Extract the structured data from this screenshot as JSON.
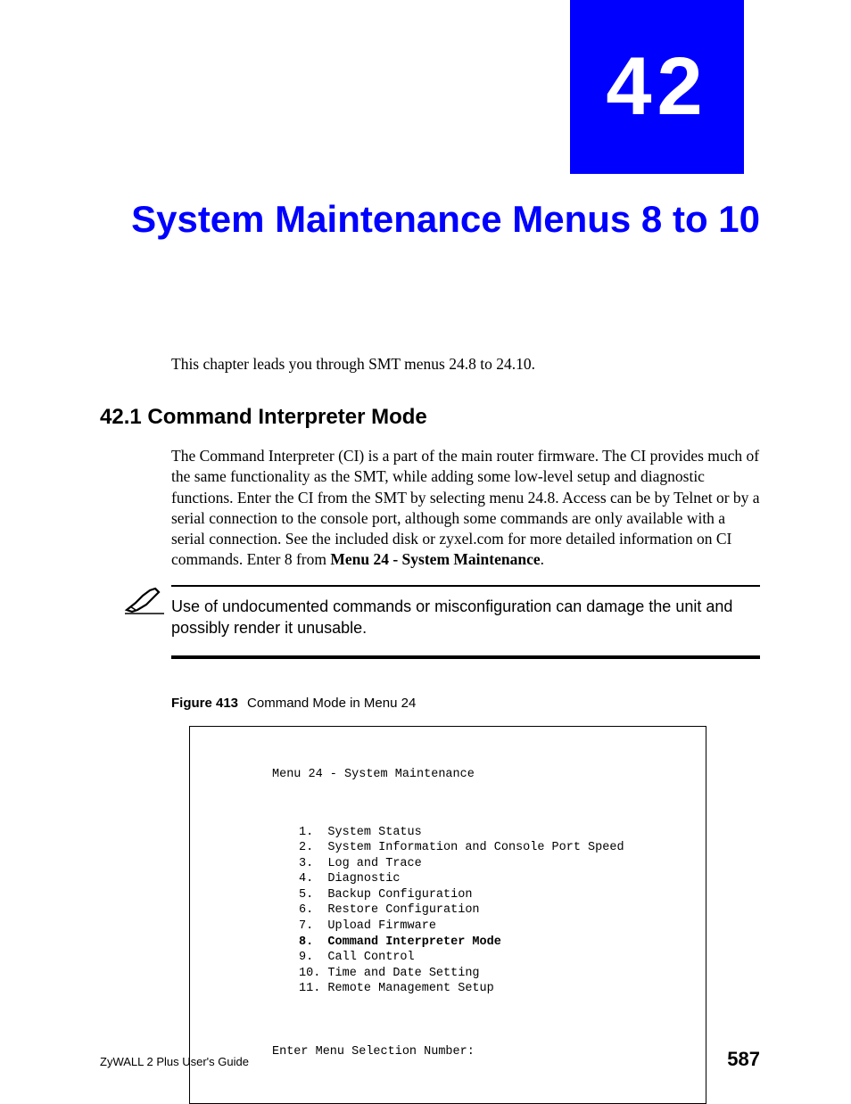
{
  "chapter": {
    "number": "42",
    "title": "System Maintenance Menus 8 to 10"
  },
  "intro": "This chapter leads you through SMT menus 24.8 to 24.10.",
  "section": {
    "heading": "42.1  Command Interpreter Mode",
    "para_part1": "The Command Interpreter (CI) is a part of the main router firmware. The CI provides much of the same functionality as the SMT, while adding some low-level setup and diagnostic functions. Enter the CI from the SMT by selecting menu 24.8. Access can be by Telnet or by a serial connection to the console port, although some commands are only available with a serial connection. See the included disk or zyxel.com for more detailed information on CI commands. Enter 8 from ",
    "para_bold": "Menu 24 - System Maintenance",
    "para_part2": "."
  },
  "note": {
    "text": "Use of undocumented commands or misconfiguration can damage the unit and possibly render it unusable."
  },
  "figure": {
    "label": "Figure 413",
    "caption": "Command Mode in Menu 24",
    "menu_title": "Menu 24 - System Maintenance",
    "items": [
      "1.  System Status",
      "2.  System Information and Console Port Speed",
      "3.  Log and Trace",
      "4.  Diagnostic",
      "5.  Backup Configuration",
      "6.  Restore Configuration",
      "7.  Upload Firmware",
      "8.  Command Interpreter Mode",
      "9.  Call Control",
      "10. Time and Date Setting",
      "11. Remote Management Setup"
    ],
    "highlight_index": 7,
    "prompt": "Enter Menu Selection Number:"
  },
  "footer": {
    "guide": "ZyWALL 2 Plus User's Guide",
    "page": "587"
  }
}
